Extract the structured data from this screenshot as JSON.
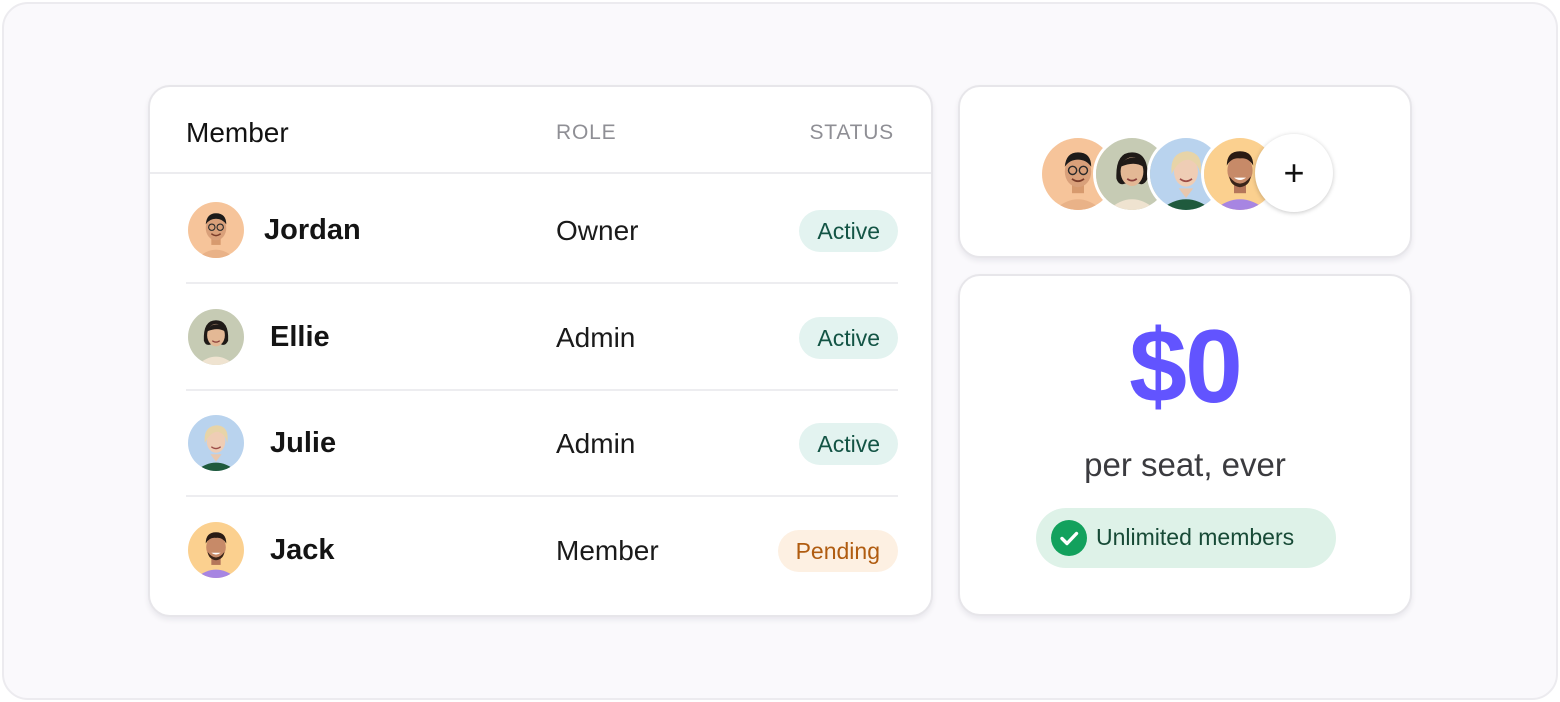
{
  "table": {
    "headers": {
      "member": "Member",
      "role": "ROLE",
      "status": "STATUS"
    },
    "rows": [
      {
        "name": "Jordan",
        "role": "Owner",
        "status": "Active",
        "status_kind": "active"
      },
      {
        "name": "Ellie",
        "role": "Admin",
        "status": "Active",
        "status_kind": "active"
      },
      {
        "name": "Julie",
        "role": "Admin",
        "status": "Active",
        "status_kind": "active"
      },
      {
        "name": "Jack",
        "role": "Member",
        "status": "Pending",
        "status_kind": "pending"
      }
    ]
  },
  "avatar_stack": {
    "members": [
      "Jordan",
      "Ellie",
      "Julie",
      "Jack"
    ],
    "add_icon": "plus-icon",
    "add_label": "+"
  },
  "pricing": {
    "price": "$0",
    "subtitle": "per seat, ever",
    "badge_icon": "check-circle-icon",
    "badge_label": "Unlimited members"
  },
  "colors": {
    "accent": "#6254ff",
    "active_bg": "#e3f3f0",
    "active_text": "#135445",
    "pending_bg": "#fdf0e2",
    "pending_text": "#b05c10",
    "success": "#13a15d"
  }
}
